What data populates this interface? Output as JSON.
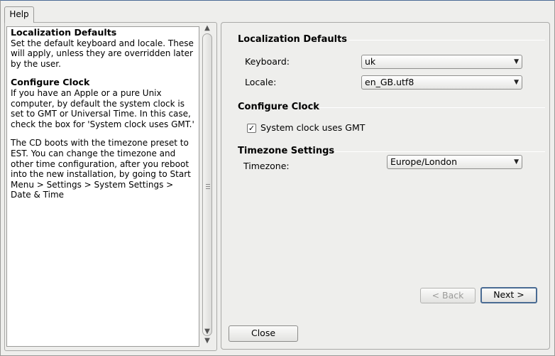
{
  "tab": {
    "label": "Help"
  },
  "help": {
    "sections": [
      {
        "heading": "Localization Defaults",
        "body": "Set the default keyboard and locale. These will apply, unless they are overridden later by the user."
      },
      {
        "heading": "Configure Clock",
        "body": "If you have an Apple or a pure Unix computer, by default the system clock is set to GMT or Universal Time. In this case, check the box for 'System clock uses GMT.'"
      },
      {
        "heading": "",
        "body": "The CD boots with the timezone preset to EST. You can change the timezone and other time configuration, after you reboot into the new installation, by going to Start Menu > Settings > System Settings > Date & Time"
      }
    ]
  },
  "localization": {
    "title": "Localization Defaults",
    "keyboard_label": "Keyboard:",
    "keyboard_value": "uk",
    "locale_label": "Locale:",
    "locale_value": "en_GB.utf8"
  },
  "clock": {
    "title": "Configure Clock",
    "gmt_label": "System clock uses GMT",
    "gmt_checked": true
  },
  "timezone": {
    "title": "Timezone Settings",
    "label": "Timezone:",
    "value": "Europe/London"
  },
  "buttons": {
    "back": "< Back",
    "next": "Next >",
    "close": "Close"
  },
  "icons": {
    "combo_arrow": "chevron-down-icon",
    "check": "checkmark-icon"
  }
}
